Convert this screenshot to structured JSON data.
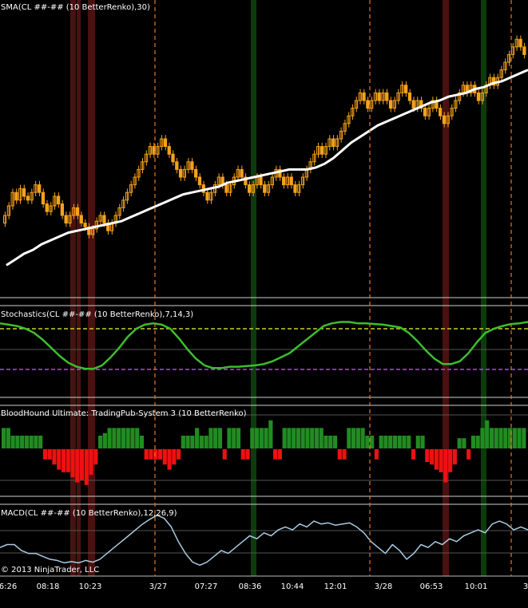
{
  "watermark": "© 2013 NinjaTrader, LLC",
  "colors": {
    "background": "#000000",
    "candle": "#f7a21b",
    "sma": "#ffffff",
    "stochastic": "#3dbd2f",
    "stoch_upper": "#c8d02a",
    "stoch_lower": "#b048e8",
    "hist_up": "#228b22",
    "hist_down": "#ee1111",
    "macd": "#a9cbe0",
    "session_line": "#e8761e",
    "green_band": "#0d3b0d",
    "red_band": "#4a1111"
  },
  "x_axis": {
    "ticks": [
      "6:26",
      "08:18",
      "10:23",
      "3/27",
      "07:27",
      "08:36",
      "10:44",
      "12:01",
      "3/28",
      "06:53",
      "10:01",
      "3"
    ]
  },
  "chart_data": [
    {
      "type": "candlestick",
      "title": "SMA(CL ##-## (10 BetterRenko),30)",
      "close": [
        0.5,
        0.55,
        0.62,
        0.58,
        0.64,
        0.6,
        0.58,
        0.62,
        0.66,
        0.62,
        0.56,
        0.52,
        0.55,
        0.6,
        0.56,
        0.5,
        0.46,
        0.5,
        0.54,
        0.5,
        0.46,
        0.44,
        0.4,
        0.43,
        0.47,
        0.5,
        0.46,
        0.42,
        0.46,
        0.5,
        0.54,
        0.58,
        0.62,
        0.66,
        0.7,
        0.74,
        0.78,
        0.82,
        0.86,
        0.82,
        0.86,
        0.9,
        0.86,
        0.82,
        0.78,
        0.74,
        0.7,
        0.74,
        0.78,
        0.74,
        0.7,
        0.66,
        0.62,
        0.58,
        0.62,
        0.66,
        0.7,
        0.66,
        0.62,
        0.66,
        0.7,
        0.74,
        0.7,
        0.66,
        0.62,
        0.66,
        0.7,
        0.66,
        0.62,
        0.66,
        0.7,
        0.74,
        0.7,
        0.66,
        0.7,
        0.66,
        0.62,
        0.66,
        0.7,
        0.74,
        0.78,
        0.82,
        0.86,
        0.82,
        0.86,
        0.9,
        0.86,
        0.9,
        0.94,
        0.98,
        1.02,
        1.06,
        1.1,
        1.14,
        1.1,
        1.06,
        1.1,
        1.14,
        1.1,
        1.14,
        1.1,
        1.06,
        1.1,
        1.14,
        1.18,
        1.14,
        1.1,
        1.06,
        1.1,
        1.06,
        1.02,
        1.06,
        1.1,
        1.06,
        1.02,
        0.98,
        1.02,
        1.06,
        1.1,
        1.14,
        1.18,
        1.14,
        1.18,
        1.14,
        1.1,
        1.14,
        1.18,
        1.22,
        1.18,
        1.22,
        1.26,
        1.3,
        1.34,
        1.38,
        1.42,
        1.38,
        1.34
      ],
      "sma": [
        0.24,
        0.27,
        0.3,
        0.32,
        0.35,
        0.37,
        0.39,
        0.41,
        0.42,
        0.43,
        0.44,
        0.45,
        0.46,
        0.47,
        0.49,
        0.51,
        0.53,
        0.55,
        0.57,
        0.59,
        0.61,
        0.62,
        0.63,
        0.64,
        0.65,
        0.67,
        0.68,
        0.69,
        0.7,
        0.71,
        0.72,
        0.73,
        0.74,
        0.74,
        0.74,
        0.75,
        0.77,
        0.8,
        0.84,
        0.88,
        0.91,
        0.94,
        0.97,
        0.99,
        1.01,
        1.03,
        1.05,
        1.07,
        1.09,
        1.1,
        1.12,
        1.13,
        1.14,
        1.16,
        1.17,
        1.19,
        1.2,
        1.22,
        1.24,
        1.26
      ]
    },
    {
      "type": "line",
      "title": "Stochastics(CL ##-## (10 BetterRenko),7,14,3)",
      "upper_level": 80,
      "lower_level": 20,
      "ylim": [
        0,
        100
      ],
      "values": [
        88,
        86,
        84,
        80,
        74,
        64,
        52,
        40,
        30,
        24,
        21,
        21,
        26,
        38,
        52,
        68,
        80,
        86,
        88,
        86,
        80,
        66,
        50,
        36,
        26,
        22,
        22,
        24,
        24,
        25,
        26,
        28,
        32,
        38,
        44,
        54,
        64,
        74,
        84,
        88,
        90,
        90,
        88,
        88,
        87,
        86,
        84,
        82,
        74,
        62,
        48,
        36,
        28,
        28,
        32,
        44,
        60,
        74,
        80,
        84,
        87,
        88,
        90
      ]
    },
    {
      "type": "bar",
      "title": "BloodHound Ultimate: TradingPub-System 3 (10 BetterRenko)",
      "values": [
        0.8,
        0.8,
        0.5,
        0.5,
        0.5,
        0.5,
        0.5,
        0.5,
        0.5,
        -0.4,
        -0.4,
        -0.6,
        -0.8,
        -0.9,
        -0.9,
        -1.1,
        -1.3,
        -1.2,
        -1.4,
        -1.0,
        -0.6,
        0.5,
        0.6,
        0.8,
        0.8,
        0.8,
        0.8,
        0.8,
        0.8,
        0.8,
        0.5,
        -0.4,
        -0.4,
        -0.4,
        -0.4,
        -0.6,
        -0.8,
        -0.6,
        -0.4,
        0.5,
        0.5,
        0.5,
        0.8,
        0.5,
        0.5,
        0.8,
        0.8,
        0.8,
        -0.4,
        0.8,
        0.8,
        0.8,
        -0.4,
        -0.4,
        0.8,
        0.8,
        0.8,
        0.8,
        1.1,
        -0.4,
        -0.4,
        0.8,
        0.8,
        0.8,
        0.8,
        0.8,
        0.8,
        0.8,
        0.8,
        0.8,
        0.5,
        0.5,
        0.5,
        -0.4,
        -0.4,
        0.8,
        0.8,
        0.8,
        0.8,
        0.5,
        0.5,
        -0.4,
        0.5,
        0.5,
        0.5,
        0.5,
        0.5,
        0.5,
        0.5,
        -0.4,
        0.5,
        0.5,
        -0.5,
        -0.6,
        -0.8,
        -0.9,
        -1.3,
        -0.9,
        -0.6,
        0.4,
        0.4,
        -0.4,
        0.5,
        0.5,
        0.8,
        1.1,
        0.8,
        0.8,
        0.8,
        0.8,
        0.8,
        0.8,
        0.8,
        0.8
      ]
    },
    {
      "type": "line",
      "title": "MACD(CL ##-## (10 BetterRenko),12,26,9)",
      "values": [
        0.0,
        0.05,
        0.05,
        -0.05,
        -0.1,
        -0.1,
        -0.15,
        -0.2,
        -0.22,
        -0.26,
        -0.24,
        -0.26,
        -0.22,
        -0.25,
        -0.2,
        -0.1,
        0.0,
        0.1,
        0.2,
        0.3,
        0.4,
        0.48,
        0.55,
        0.5,
        0.35,
        0.1,
        -0.1,
        -0.25,
        -0.3,
        -0.25,
        -0.15,
        -0.05,
        -0.1,
        0.0,
        0.1,
        0.2,
        0.15,
        0.25,
        0.2,
        0.3,
        0.35,
        0.3,
        0.4,
        0.35,
        0.45,
        0.4,
        0.42,
        0.38,
        0.4,
        0.42,
        0.35,
        0.25,
        0.1,
        0.0,
        -0.1,
        0.05,
        -0.05,
        -0.2,
        -0.1,
        0.05,
        0.0,
        0.1,
        0.05,
        0.15,
        0.1,
        0.2,
        0.25,
        0.3,
        0.25,
        0.4,
        0.45,
        0.4,
        0.3,
        0.35,
        0.3
      ],
      "signal": [
        0.0,
        0.0,
        0.0,
        -0.02,
        -0.04,
        -0.06,
        -0.08,
        -0.11,
        -0.13,
        -0.16,
        -0.18,
        -0.19,
        -0.2,
        -0.21,
        -0.2,
        -0.18,
        -0.14,
        -0.09,
        -0.03,
        0.05,
        0.12,
        0.2,
        0.27,
        0.31,
        0.32,
        0.28,
        0.2,
        0.11,
        0.03,
        -0.02,
        -0.05,
        -0.05,
        -0.06,
        -0.04,
        0.0,
        0.04,
        0.06,
        0.1,
        0.12,
        0.16,
        0.19,
        0.21,
        0.25,
        0.27,
        0.31,
        0.33,
        0.35,
        0.36,
        0.37,
        0.38,
        0.37,
        0.35,
        0.3,
        0.24,
        0.17,
        0.14,
        0.1,
        0.04,
        0.01,
        0.02,
        0.01,
        0.03,
        0.03,
        0.05,
        0.06,
        0.09,
        0.12,
        0.16,
        0.18,
        0.22,
        0.27,
        0.3,
        0.3,
        0.31,
        0.31
      ]
    }
  ]
}
